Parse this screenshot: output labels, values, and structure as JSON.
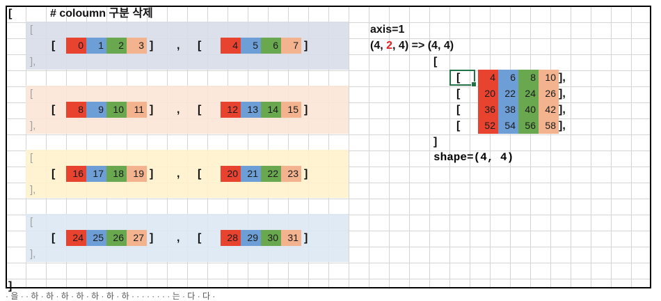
{
  "title_text": "# coloumn 구분 삭제",
  "outer_open": "[",
  "outer_close": "]",
  "inner_open": "[",
  "inner_close": "],",
  "pair_sep": ",",
  "axis_label": "axis=1",
  "shape_expr": {
    "prefix": "(4, ",
    "highlight": "2",
    "suffix": ", 4) => (4, 4)"
  },
  "shape_result": "shape=(4, 4)",
  "colors": {
    "red": "#e8432e",
    "blue": "#6d9ed6",
    "green": "#6aa84f",
    "peach": "#f2b38e",
    "band1": "#d8dde8",
    "band2": "#fbe5d6",
    "band3": "#fff2cc",
    "band4": "#dde8f4",
    "highlight_text": "#e02020"
  },
  "left_groups": [
    {
      "a": [
        "0",
        "1",
        "2",
        "3"
      ],
      "b": [
        "4",
        "5",
        "6",
        "7"
      ]
    },
    {
      "a": [
        "8",
        "9",
        "10",
        "11"
      ],
      "b": [
        "12",
        "13",
        "14",
        "15"
      ]
    },
    {
      "a": [
        "16",
        "17",
        "18",
        "19"
      ],
      "b": [
        "20",
        "21",
        "22",
        "23"
      ]
    },
    {
      "a": [
        "24",
        "25",
        "26",
        "27"
      ],
      "b": [
        "28",
        "29",
        "30",
        "31"
      ]
    }
  ],
  "result_rows": [
    [
      "4",
      "6",
      "8",
      "10"
    ],
    [
      "20",
      "22",
      "24",
      "26"
    ],
    [
      "36",
      "38",
      "40",
      "42"
    ],
    [
      "52",
      "54",
      "56",
      "58"
    ]
  ],
  "row_close": "],",
  "seg_close": "]",
  "result_open": "[",
  "result_close": "]",
  "footer_text": "· 을 · · 하 · 하 · 하 · 하 · 하 · 하 · 하 · · · · · · · · 는 · 다 · 다 ·"
}
